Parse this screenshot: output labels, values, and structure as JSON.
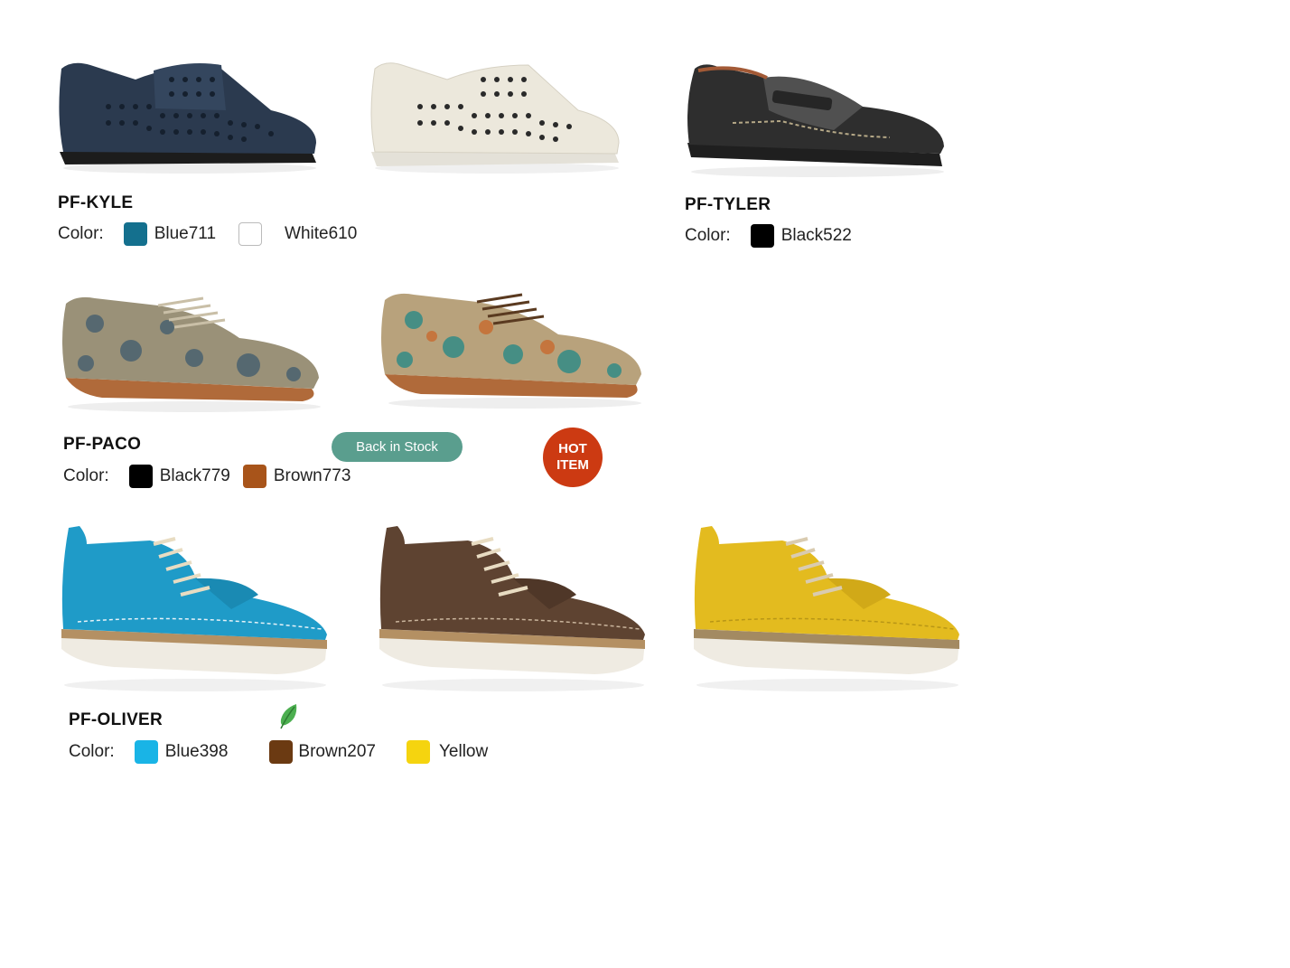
{
  "products": [
    {
      "name": "PF-KYLE",
      "color_label": "Color:",
      "variants": [
        {
          "label": "Blue711",
          "swatch": "#14708e",
          "shoe_color": "#2b3a4f",
          "style": "loafer-perforated"
        },
        {
          "label": "White610",
          "swatch": "#ffffff",
          "shoe_color": "#ece8dc",
          "style": "loafer-perforated"
        }
      ]
    },
    {
      "name": "PF-TYLER",
      "color_label": "Color:",
      "variants": [
        {
          "label": "Black522",
          "swatch": "#000000",
          "shoe_color": "#2e2e2e",
          "style": "penny-loafer"
        }
      ]
    },
    {
      "name": "PF-PACO",
      "color_label": "Color:",
      "variants": [
        {
          "label": "Black779",
          "swatch": "#000000",
          "shoe_color": "#9a9178",
          "style": "floral-oxford"
        },
        {
          "label": "Brown773",
          "swatch": "#a8541a",
          "shoe_color": "#b8a27c",
          "style": "floral-oxford"
        }
      ],
      "badges": {
        "stock": "Back in Stock",
        "hot_line1": "HOT",
        "hot_line2": "ITEM"
      }
    },
    {
      "name": "PF-OLIVER",
      "color_label": "Color:",
      "variants": [
        {
          "label": "Blue398",
          "swatch": "#19b4e6",
          "shoe_color": "#1f9bc8",
          "style": "chukka"
        },
        {
          "label": "Brown207",
          "swatch": "#6b3a12",
          "shoe_color": "#5e4331",
          "style": "chukka"
        },
        {
          "label": "Yellow",
          "swatch": "#f5d40f",
          "shoe_color": "#e3bb1f",
          "style": "chukka"
        }
      ],
      "eco_icon": "leaf-icon"
    }
  ]
}
